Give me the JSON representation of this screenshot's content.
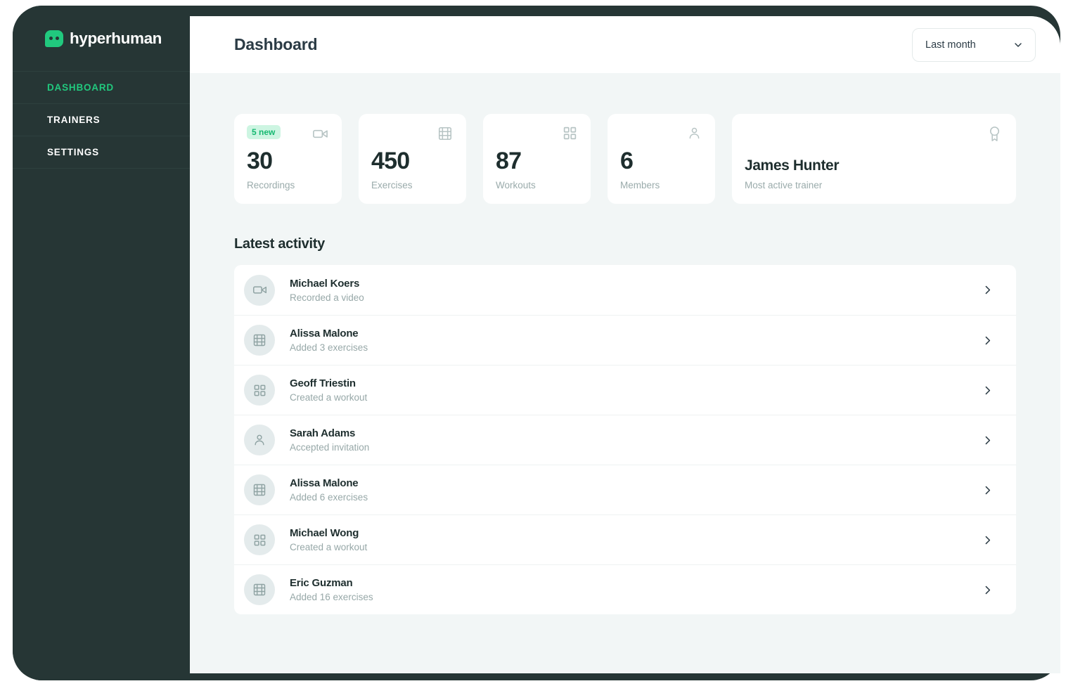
{
  "brand": {
    "name": "hyperhuman",
    "logo_icon": "hyperhuman-logo-icon",
    "accent_color": "#21c97e"
  },
  "sidebar": {
    "items": [
      {
        "label": "DASHBOARD",
        "active": true
      },
      {
        "label": "TRAINERS",
        "active": false
      },
      {
        "label": "SETTINGS",
        "active": false
      }
    ]
  },
  "header": {
    "title": "Dashboard",
    "period_select": {
      "value": "Last month",
      "chevron_icon": "chevron-down-icon"
    }
  },
  "stats": [
    {
      "badge": "5 new",
      "value": "30",
      "label": "Recordings",
      "icon": "video-camera-icon"
    },
    {
      "badge": null,
      "value": "450",
      "label": "Exercises",
      "icon": "film-strip-icon"
    },
    {
      "badge": null,
      "value": "87",
      "label": "Workouts",
      "icon": "grid-icon"
    },
    {
      "badge": null,
      "value": "6",
      "label": "Members",
      "icon": "user-icon"
    }
  ],
  "featured": {
    "name": "James Hunter",
    "label": "Most active trainer",
    "icon": "award-ribbon-icon"
  },
  "activity": {
    "heading": "Latest activity",
    "rows": [
      {
        "name": "Michael Koers",
        "desc": "Recorded a video",
        "icon": "video-camera-icon"
      },
      {
        "name": "Alissa Malone",
        "desc": "Added 3 exercises",
        "icon": "film-strip-icon"
      },
      {
        "name": "Geoff Triestin",
        "desc": "Created a workout",
        "icon": "grid-icon"
      },
      {
        "name": "Sarah Adams",
        "desc": "Accepted invitation",
        "icon": "user-icon"
      },
      {
        "name": "Alissa Malone",
        "desc": "Added 6 exercises",
        "icon": "film-strip-icon"
      },
      {
        "name": "Michael Wong",
        "desc": "Created a workout",
        "icon": "grid-icon"
      },
      {
        "name": "Eric Guzman",
        "desc": "Added 16 exercises",
        "icon": "film-strip-icon"
      }
    ],
    "row_chevron_icon": "chevron-right-icon"
  }
}
